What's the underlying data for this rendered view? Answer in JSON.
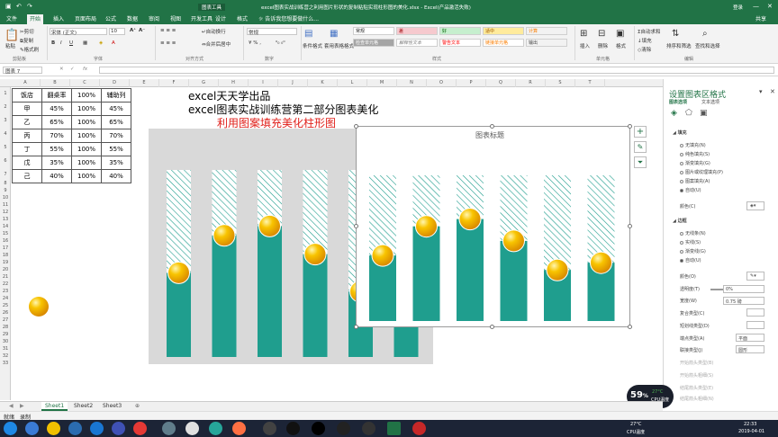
{
  "window": {
    "context_tab": "图表工具",
    "title": "excel图表实战训练营之利用图片形状的复制粘贴实现柱形图的美化.xlsx - Excel(产品激活失败)",
    "login": "登录"
  },
  "tabs": [
    "文件",
    "开始",
    "插入",
    "页面布局",
    "公式",
    "数据",
    "审阅",
    "视图",
    "开发工具",
    "设计",
    "格式"
  ],
  "tell_me": "告诉我您想要做什么...",
  "share": "共享",
  "ribbon": {
    "paste": "粘贴",
    "cut": "剪切",
    "copy": "复制",
    "format_painter": "格式刷",
    "font_name": "宋体 (正文)",
    "font_size": "10",
    "wrap": "自动换行",
    "merge": "合并后居中",
    "number_format": "常规",
    "cond_format": "条件格式",
    "table_format": "套用表格格式",
    "styles": [
      "常规",
      "差",
      "好",
      "适中",
      "检查单元格",
      "解释性文本",
      "警告文本",
      "链接单元格",
      "计算",
      "输出"
    ],
    "insert": "插入",
    "delete": "删除",
    "format": "格式",
    "autosum": "自动求和",
    "fill": "填充",
    "clear": "清除",
    "sort_filter": "排序和筛选",
    "find_select": "查找和选择",
    "groups": [
      "剪贴板",
      "字体",
      "对齐方式",
      "数字",
      "样式",
      "单元格",
      "编辑"
    ]
  },
  "name_box": "图表 7",
  "columns": [
    "A",
    "B",
    "C",
    "D",
    "E",
    "F",
    "G",
    "H",
    "I",
    "J",
    "K",
    "L",
    "M",
    "N",
    "O",
    "P",
    "Q",
    "R",
    "S",
    "T"
  ],
  "rows": [
    "1",
    "2",
    "3",
    "4",
    "5",
    "6",
    "7",
    "8",
    "9",
    "10",
    "11",
    "12",
    "13",
    "14",
    "15",
    "16",
    "17",
    "18",
    "19",
    "20",
    "21",
    "22",
    "23",
    "24",
    "25",
    "26",
    "27",
    "28",
    "29",
    "30",
    "31",
    "32",
    "33"
  ],
  "table": {
    "header": [
      "饭店",
      "翻桌率",
      "100%",
      "辅助列"
    ],
    "rows": [
      [
        "甲",
        "45%",
        "100%",
        "45%"
      ],
      [
        "乙",
        "65%",
        "100%",
        "65%"
      ],
      [
        "丙",
        "70%",
        "100%",
        "70%"
      ],
      [
        "丁",
        "55%",
        "100%",
        "55%"
      ],
      [
        "戊",
        "35%",
        "100%",
        "35%"
      ],
      [
        "己",
        "40%",
        "100%",
        "40%"
      ]
    ]
  },
  "text_lines": {
    "line1": "excel天天学出品",
    "line2": "excel图表实战训练营第二部分图表美化",
    "line3": "利用图案填充美化柱形图"
  },
  "chart_data": [
    {
      "type": "bar",
      "categories": [
        "甲",
        "乙",
        "丙",
        "丁",
        "戊",
        "己"
      ],
      "series": [
        {
          "name": "翻桌率",
          "values": [
            45,
            65,
            70,
            55,
            35,
            40
          ]
        },
        {
          "name": "100%",
          "values": [
            100,
            100,
            100,
            100,
            100,
            100
          ]
        }
      ],
      "ylim": [
        0,
        100
      ],
      "title": ""
    },
    {
      "type": "bar",
      "categories": [
        "甲",
        "乙",
        "丙",
        "丁",
        "戊",
        "己"
      ],
      "series": [
        {
          "name": "翻桌率",
          "values": [
            45,
            65,
            70,
            55,
            35,
            40
          ]
        },
        {
          "name": "100%",
          "values": [
            100,
            100,
            100,
            100,
            100,
            100
          ]
        }
      ],
      "ylim": [
        0,
        100
      ],
      "title": "图表标题"
    }
  ],
  "colors": {
    "excel_green": "#217346",
    "bar_teal": "#1f9e8e",
    "ball": "#f5b400",
    "title_red": "#e0201b"
  },
  "side_panel": {
    "title": "设置图表区格式",
    "tab1": "图表选项",
    "tab2": "文本选项",
    "fill_header": "填充",
    "fill_options": [
      "无填充(N)",
      "纯色填充(S)",
      "渐变填充(G)",
      "图片或纹理填充(P)",
      "图案填充(A)",
      "自动(U)"
    ],
    "color_label": "颜色(C)",
    "border_header": "边框",
    "border_options": [
      "无线条(N)",
      "实线(S)",
      "渐变线(G)",
      "自动(U)"
    ],
    "border_color": "颜色(O)",
    "transparency": "透明度(T)",
    "transparency_value": "0%",
    "width": "宽度(W)",
    "width_value": "0.75 磅",
    "compound": "复合类型(C)",
    "dash": "短划线类型(D)",
    "cap": "端点类型(A)",
    "cap_value": "平面",
    "join": "联接类型(J)",
    "join_value": "圆形",
    "begin_arrow": "开始箭头类型(B)",
    "begin_size": "开始箭头粗细(S)",
    "end_arrow": "结尾箭头类型(E)",
    "end_size": "结尾箭头粗细(N)"
  },
  "sheets": [
    "Sheet1",
    "Sheet2",
    "Sheet3"
  ],
  "status": {
    "ready": "就绪",
    "macro": "录制",
    "percent": "59",
    "cpu": "CPU温度",
    "temp": "27°C"
  },
  "taskbar": {
    "temp": "27°C",
    "cpu": "CPU温度",
    "time": "22:33",
    "date": "2019-04-01"
  }
}
